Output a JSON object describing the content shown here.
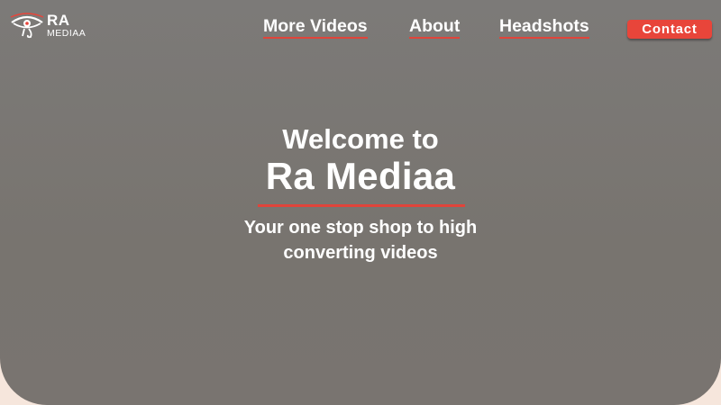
{
  "logo": {
    "icon": "eye-of-ra-icon",
    "line1": "RA",
    "line2": "MEDIAA"
  },
  "nav": {
    "items": [
      {
        "label": "More Videos"
      },
      {
        "label": "About"
      },
      {
        "label": "Headshots"
      }
    ],
    "contact_label": "Contact"
  },
  "hero": {
    "welcome": "Welcome to",
    "brand": "Ra Mediaa",
    "tagline_line1": "Your one stop shop to high",
    "tagline_line2": "converting videos"
  },
  "colors": {
    "accent": "#e8453a",
    "hero_bg": "#7a7774",
    "page_bg": "#f6e6dc",
    "text": "#ffffff"
  }
}
